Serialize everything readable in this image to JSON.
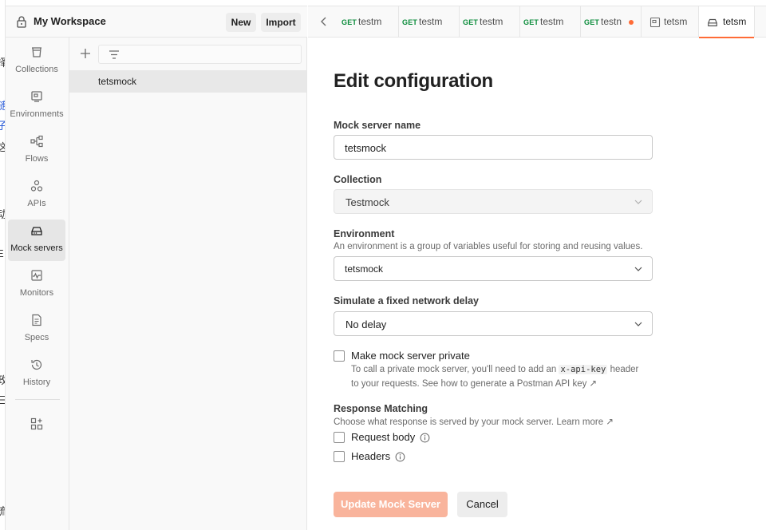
{
  "background_window": {
    "glyphs": [
      "择",
      "随",
      "子",
      "这",
      "动",
      "E",
      "政",
      "三",
      "流"
    ]
  },
  "header": {
    "workspace_name": "My Workspace",
    "new_label": "New",
    "import_label": "Import"
  },
  "sidebar": {
    "items": [
      {
        "label": "Collections",
        "icon": "collections-icon"
      },
      {
        "label": "Environments",
        "icon": "environments-icon"
      },
      {
        "label": "Flows",
        "icon": "flows-icon"
      },
      {
        "label": "APIs",
        "icon": "apis-icon"
      },
      {
        "label": "Mock servers",
        "icon": "mock-servers-icon",
        "active": true
      },
      {
        "label": "Monitors",
        "icon": "monitors-icon"
      },
      {
        "label": "Specs",
        "icon": "specs-icon"
      },
      {
        "label": "History",
        "icon": "history-icon"
      }
    ]
  },
  "list": {
    "items": [
      {
        "name": "tetsmock",
        "selected": true
      }
    ]
  },
  "tabs": [
    {
      "method": "GET",
      "name": "testm"
    },
    {
      "method": "GET",
      "name": "testm"
    },
    {
      "method": "GET",
      "name": "testm"
    },
    {
      "method": "GET",
      "name": "testm"
    },
    {
      "method": "GET",
      "name": "testn",
      "unsaved": true
    },
    {
      "method": "",
      "name": "tetsm",
      "icon": "request-icon"
    },
    {
      "method": "",
      "name": "tetsm",
      "icon": "mock-server-icon",
      "active": true
    }
  ],
  "form": {
    "title": "Edit configuration",
    "mock_name_label": "Mock server name",
    "mock_name_value": "tetsmock",
    "collection_label": "Collection",
    "collection_value": "Testmock",
    "environment_label": "Environment",
    "environment_help": "An environment is a group of variables useful for storing and reusing values.",
    "environment_value": "tetsmock",
    "delay_label": "Simulate a fixed network delay",
    "delay_value": "No delay",
    "private_label": "Make mock server private",
    "private_help_before": "To call a private mock server, you'll need to add an",
    "private_help_code": "x-api-key",
    "private_help_after": "header",
    "private_help_line2": "to your requests. See how to generate a Postman API key ↗",
    "private_checked": false,
    "matching_label": "Response Matching",
    "matching_help": "Choose what response is served by your mock server. Learn more ↗",
    "request_body_label": "Request body",
    "request_body_checked": false,
    "headers_label": "Headers",
    "headers_checked": false,
    "update_label": "Update Mock Server",
    "cancel_label": "Cancel"
  },
  "colors": {
    "accent": "#ff6c37",
    "accent_disabled": "#f9b49c",
    "get_method": "#0a8c3a"
  }
}
